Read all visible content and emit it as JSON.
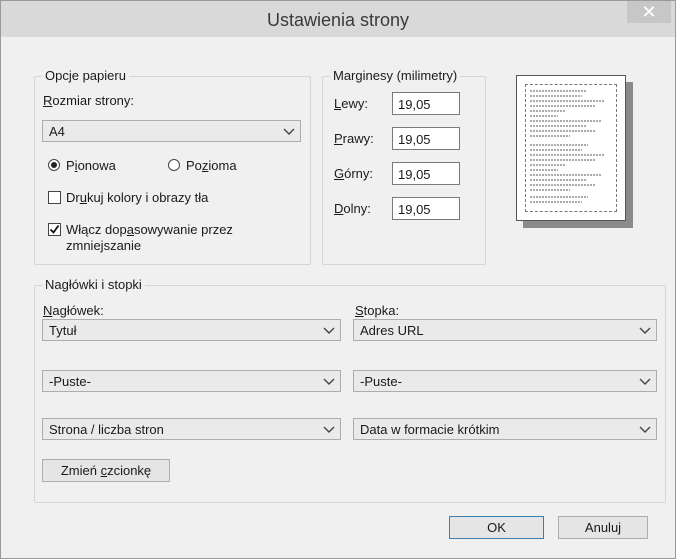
{
  "window": {
    "title": "Ustawienia strony",
    "close_glyph": "✕"
  },
  "paper": {
    "legend": "Opcje papieru",
    "size_label": "Rozmiar strony:",
    "size_value": "A4",
    "orientation_portrait": "Pionowa",
    "orientation_landscape": "Pozioma",
    "orientation_selected": "portrait",
    "print_colors_label": "Drukuj kolory i obrazy tła",
    "print_colors_checked": false,
    "shrink_label_line1": "Włącz dopasowywanie przez",
    "shrink_label_line2": "zmniejszanie",
    "shrink_checked": true
  },
  "margins": {
    "legend": "Marginesy (milimetry)",
    "left_label": "Lewy:",
    "left_value": "19,05",
    "right_label": "Prawy:",
    "right_value": "19,05",
    "top_label": "Górny:",
    "top_value": "19,05",
    "bottom_label": "Dolny:",
    "bottom_value": "19,05"
  },
  "headers_footers": {
    "legend": "Nagłówki i stopki",
    "header_label": "Nagłówek:",
    "footer_label": "Stopka:",
    "header_values": [
      "Tytuł",
      "-Puste-",
      "Strona / liczba stron"
    ],
    "footer_values": [
      "Adres URL",
      "-Puste-",
      "Data w formacie krótkim"
    ],
    "change_font_label": "Zmień czcionkę"
  },
  "buttons": {
    "ok": "OK",
    "cancel": "Anuluj"
  }
}
